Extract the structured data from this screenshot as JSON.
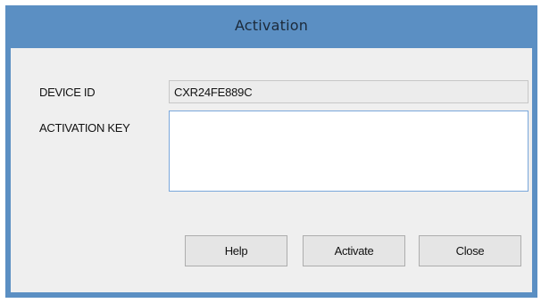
{
  "window": {
    "title": "Activation"
  },
  "form": {
    "device_id_label": "DEVICE ID",
    "device_id_value": "CXR24FE889C",
    "activation_key_label": "ACTIVATION KEY",
    "activation_key_value": ""
  },
  "buttons": {
    "help_label": "Help",
    "activate_label": "Activate",
    "close_label": "Close"
  },
  "colors": {
    "titlebar": "#5b8fc3",
    "client_background": "#efefef",
    "focus_border": "#7aa7db"
  }
}
